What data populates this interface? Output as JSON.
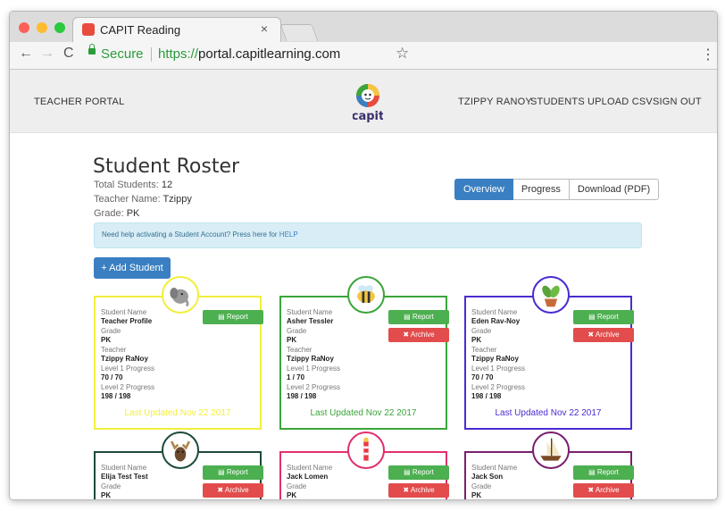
{
  "browser": {
    "tab_title": "CAPIT Reading",
    "tab_close": "×",
    "secure_label": "Secure",
    "url_proto": "https://",
    "url_host": "portal.capitlearning.com",
    "back": "←",
    "forward": "→",
    "reload": "C",
    "star": "☆",
    "menu": "⋮"
  },
  "header": {
    "brand": "TEACHER PORTAL",
    "logo_text": "capit",
    "nav": [
      "TZIPPY RANOY",
      "STUDENTS",
      "UPLOAD CSV",
      "SIGN OUT"
    ]
  },
  "roster": {
    "title": "Student Roster",
    "total_label": "Total Students:",
    "total_value": "12",
    "teacher_label": "Teacher Name:",
    "teacher_value": "Tzippy",
    "grade_label": "Grade:",
    "grade_value": "PK",
    "tabs": [
      "Overview",
      "Progress",
      "Download (PDF)"
    ],
    "alert_text": "Need help activating a Student Account? Press here for ",
    "alert_link": "HELP",
    "add_label": "+ Add Student"
  },
  "labels": {
    "student_name": "Student Name",
    "grade": "Grade",
    "teacher": "Teacher",
    "level1": "Level 1 Progress",
    "level2": "Level 2 Progress",
    "report": "Report",
    "archive": "✖ Archive",
    "updated_prefix": "Last Updated "
  },
  "students": [
    {
      "name": "Teacher Profile",
      "grade": "PK",
      "teacher": "Tzippy RaNoy",
      "level1": "70 / 70",
      "level2": "198 / 198",
      "updated": "Nov 22 2017",
      "color": "#f2ef3c",
      "icon": "elephant-icon",
      "archive": false
    },
    {
      "name": "Asher Tessler",
      "grade": "PK",
      "teacher": "Tzippy RaNoy",
      "level1": "1 / 70",
      "level2": "198 / 198",
      "updated": "Nov 22 2017",
      "color": "#3aa53a",
      "icon": "bee-icon",
      "archive": true
    },
    {
      "name": "Eden Rav-Noy",
      "grade": "PK",
      "teacher": "Tzippy RaNoy",
      "level1": "70 / 70",
      "level2": "198 / 198",
      "updated": "Nov 22 2017",
      "color": "#4b2bd1",
      "icon": "plant-icon",
      "archive": true
    },
    {
      "name": "Elija Test Test",
      "grade": "PK",
      "color": "#1e4b3a",
      "icon": "moose-icon",
      "archive": true
    },
    {
      "name": "Jack Lomen",
      "grade": "PK",
      "color": "#e0306f",
      "icon": "lighthouse-icon",
      "archive": true
    },
    {
      "name": "Jack Son",
      "grade": "PK",
      "color": "#7a1f6e",
      "icon": "ship-icon",
      "archive": true
    }
  ]
}
